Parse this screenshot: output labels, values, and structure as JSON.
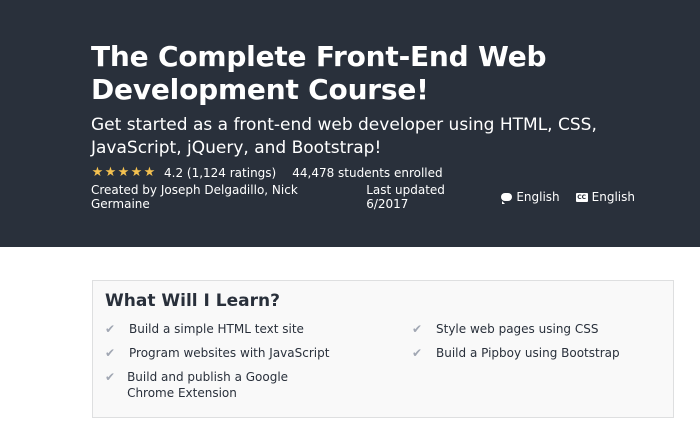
{
  "course": {
    "title": "The Complete Front-End Web Development Course!",
    "subtitle": "Get started as a front-end web developer using HTML, CSS, JavaScript, jQuery, and Bootstrap!",
    "rating": {
      "stars_filled": 4.2,
      "stars_max": 5,
      "text": "4.2 (1,124 ratings)"
    },
    "enrolled": "44,478 students enrolled",
    "created_by": "Created by Joseph Delgadillo, Nick Germaine",
    "last_updated": "Last updated 6/2017",
    "language": "English",
    "captions": "English",
    "captions_icon_text": "CC"
  },
  "learn": {
    "heading": "What Will I Learn?",
    "left": [
      "Build a simple HTML text site",
      "Program websites with JavaScript",
      "Build and publish a Google Chrome Extension"
    ],
    "right": [
      "Style web pages using CSS",
      "Build a Pipboy using Bootstrap"
    ]
  },
  "colors": {
    "hero_bg": "#29303b",
    "star": "#f4c150",
    "check": "#a1a7b3"
  },
  "icons": {
    "rating": "star-icon",
    "language": "speech-bubble-icon",
    "captions": "closed-captions-icon",
    "learn_item": "checkmark-icon"
  }
}
